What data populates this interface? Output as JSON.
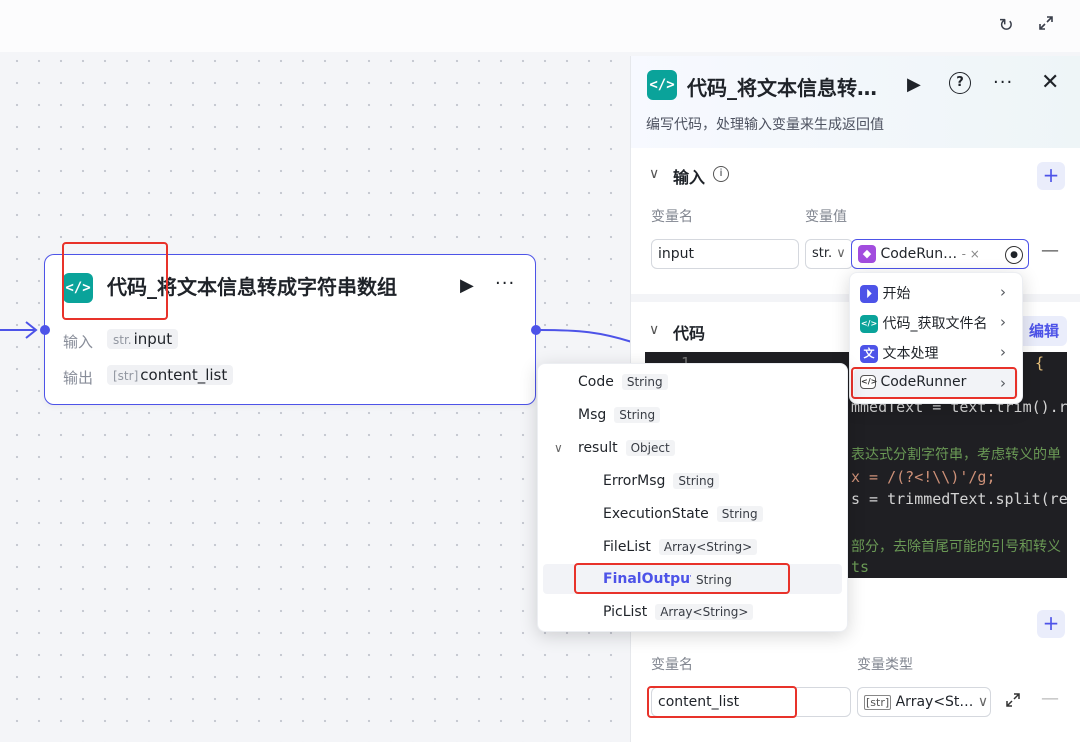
{
  "toolbar": {
    "icons": [
      "refresh-icon",
      "expand-icon"
    ]
  },
  "node": {
    "title": "代码_将文本信息转成字符串数组",
    "badge": "</>",
    "input_label": "输入",
    "input_type": "str.",
    "input_name": "input",
    "output_label": "输出",
    "output_type": "[str]",
    "output_name": "content_list"
  },
  "panel": {
    "badge": "</>",
    "title": "代码_将文本信息转…",
    "description": "编写代码，处理输入变量来生成返回值",
    "input_section": {
      "title": "输入",
      "col_name": "变量名",
      "col_value": "变量值",
      "var_name": "input",
      "var_type": "str.",
      "ref_value": "CodeRun…",
      "ref_suffix": "- ×"
    },
    "code_section": {
      "title": "代码",
      "edit_label": "编辑",
      "lines": [
        "",
        "mmedText = text.trim().re",
        "",
        "表达式分割字符串，考虑转义的单",
        "x = /(?<!\\\\)'/g;",
        "s = trimmedText.split(re",
        "",
        "部分，去除首尾可能的引号和转义",
        "ts"
      ],
      "first_line_number": "1"
    },
    "output_section": {
      "col_name": "变量名",
      "col_type": "变量类型",
      "var_name": "content_list",
      "var_type_tag": "[str]",
      "var_type": "Array<St…"
    }
  },
  "source_menu": {
    "items": [
      {
        "label": "开始",
        "icon": "start-icon",
        "color": "#4d53e8"
      },
      {
        "label": "代码_获取文件名",
        "icon": "code-icon",
        "color": "#0aa39a"
      },
      {
        "label": "文本处理",
        "icon": "text-process-icon",
        "color": "#4d53e8"
      },
      {
        "label": "CodeRunner",
        "icon": "plugin-icon",
        "color": "#ffffff"
      }
    ]
  },
  "output_menu": {
    "items": [
      {
        "label": "Code",
        "type": "String"
      },
      {
        "label": "Msg",
        "type": "String"
      },
      {
        "label": "result",
        "type": "Object"
      },
      {
        "label": "ErrorMsg",
        "type": "String"
      },
      {
        "label": "ExecutionState",
        "type": "String"
      },
      {
        "label": "FileList",
        "type": "Array<String>"
      },
      {
        "label": "FinalOutput",
        "type": "String"
      },
      {
        "label": "PicList",
        "type": "Array<String>"
      }
    ]
  }
}
